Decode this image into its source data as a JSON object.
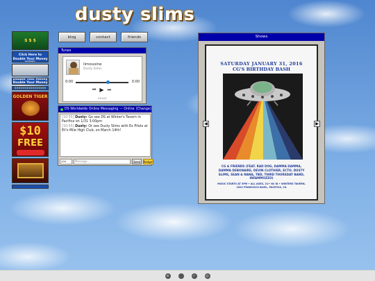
{
  "site": {
    "title": "dusty slims"
  },
  "nav": {
    "items": [
      "blog",
      "contact",
      "friends"
    ]
  },
  "ads": {
    "link1": "Click Here to Double Your Money NOW!",
    "double": "Double Your Money Double Your Money",
    "dollars": "$$$$$$$$$$$$$$$$",
    "tiger": "GOLDEN TIGER",
    "free_amount": "$10",
    "free_word": "FREE"
  },
  "tunes": {
    "title": "Tunes",
    "song": "limousine",
    "artist": "Dusty Slims",
    "time_start": "0:00",
    "time_end": "0:00",
    "status": "READY"
  },
  "chat": {
    "title": "DS Worldwide Online Messaging — Online",
    "change": "(Change)",
    "messages": [
      {
        "time": "[10:55]",
        "user": "Dusty:",
        "text": "Go see DS at Winter's Tavern in Pacifica on 1/31 3:00pm"
      },
      {
        "time": "[10:55]",
        "user": "Dusty:",
        "text": "Or see Dusty Slims with Ex Pilots at Eli's Mile High Club, on March 14th!"
      }
    ],
    "name_value": "you",
    "message_placeholder": "Message...",
    "send_label": "Send",
    "badge_label": "Badge!"
  },
  "shows": {
    "title": "Shows",
    "poster": {
      "date": "SATURDAY JANUARY 31, 2016",
      "event": "CG'S BIRTHDAY BASH",
      "lineup": "CG & FRIENDS (FEAT. RAD DOG, DAMMA DAMMA, DAMMA DEBONAIRE, DEVIN CLOTHIER, ECTO, DUSTY SLIMS, SEAN & NANA, TBD, THIRD THURSDAY BAND, INFAMMOZZO)",
      "venue": "MUSIC STARTS AT 3PM • ALL AGES, 21+ W/ ID • WINTERS TAVERN, 1522 FRANCISCO BLVD., PACIFICA, CA"
    }
  },
  "footer": {
    "icons": [
      "spotify-icon",
      "apple-icon",
      "twitter-icon",
      "instagram-icon"
    ]
  }
}
